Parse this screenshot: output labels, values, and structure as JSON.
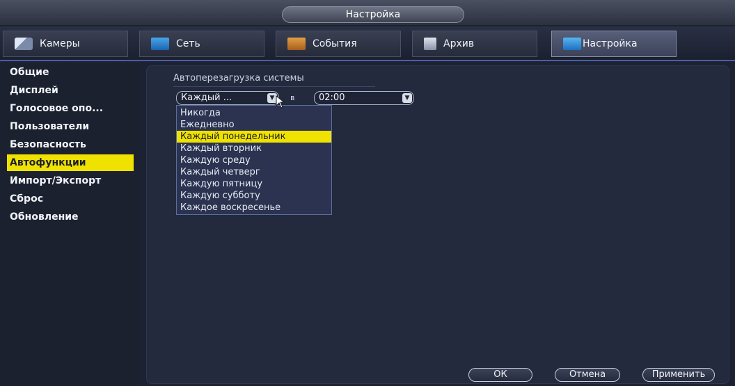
{
  "window": {
    "title": "Настройка"
  },
  "tabs": [
    {
      "label": "Камеры",
      "icon": "camera-icon"
    },
    {
      "label": "Сеть",
      "icon": "network-icon"
    },
    {
      "label": "События",
      "icon": "events-icon"
    },
    {
      "label": "Архив",
      "icon": "archive-icon"
    },
    {
      "label": "Настройка",
      "icon": "settings-icon",
      "active": true
    }
  ],
  "sidebar": {
    "items": [
      {
        "label": "Общие"
      },
      {
        "label": "Дисплей"
      },
      {
        "label": "Голосовое опо..."
      },
      {
        "label": "Пользователи"
      },
      {
        "label": "Безопасность"
      },
      {
        "label": "Автофункции",
        "active": true
      },
      {
        "label": "Импорт/Экспорт"
      },
      {
        "label": "Сброс"
      },
      {
        "label": "Обновление"
      }
    ]
  },
  "main": {
    "section_title": "Автоперезагрузка системы",
    "day_select": {
      "value": "Каждый ..."
    },
    "at_label": "в",
    "time_select": {
      "value": "02:00"
    },
    "dropdown_options": [
      "Никогда",
      "Ежедневно",
      "Каждый понедельник",
      "Каждый вторник",
      "Каждую среду",
      "Каждый четверг",
      "Каждую пятницу",
      "Каждую субботу",
      "Каждое воскресенье"
    ],
    "highlighted_option": "Каждый понедельник"
  },
  "buttons": {
    "ok": "ОК",
    "cancel": "Отмена",
    "apply": "Применить"
  },
  "colors": {
    "highlight": "#f0e200",
    "background": "#1d2232",
    "panel": "#232a3e"
  }
}
